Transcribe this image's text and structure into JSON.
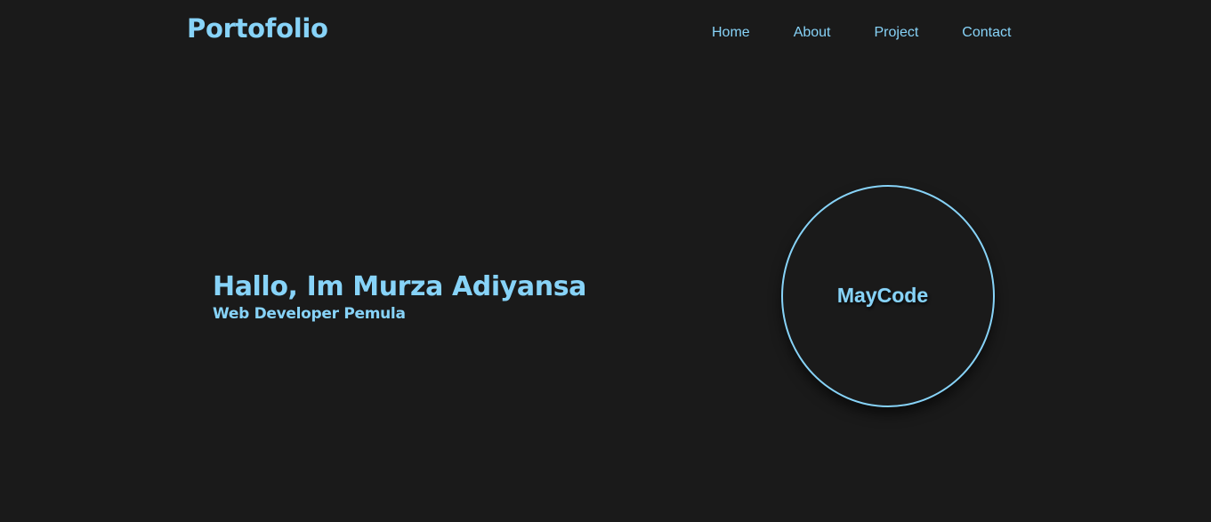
{
  "header": {
    "logo": "Portofolio",
    "nav": [
      {
        "label": "Home"
      },
      {
        "label": "About"
      },
      {
        "label": "Project"
      },
      {
        "label": "Contact"
      }
    ]
  },
  "hero": {
    "title": "Hallo, Im Murza Adiyansa",
    "subtitle": "Web Developer Pemula",
    "circle_text": "MayCode"
  },
  "colors": {
    "background": "#1a1a1a",
    "accent": "#87d3f8"
  }
}
